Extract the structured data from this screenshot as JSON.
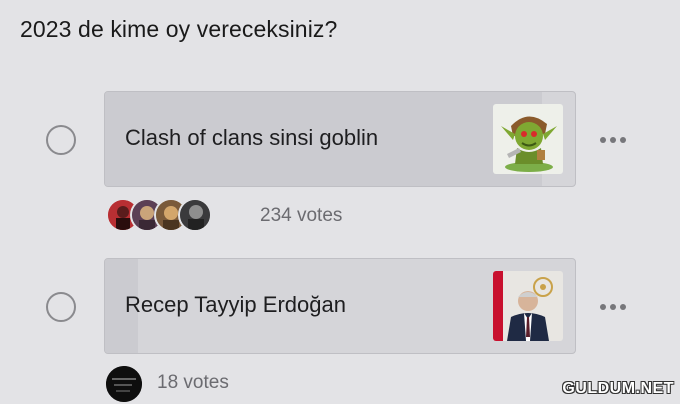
{
  "poll": {
    "question": "2023 de kime oy vereceksiniz?",
    "options": [
      {
        "label": "Clash of clans sinsi goblin",
        "votes_text": "234 votes",
        "votes": 234,
        "fill_fraction": 0.93
      },
      {
        "label": "Recep Tayyip Erdoğan",
        "votes_text": "18 votes",
        "votes": 18,
        "fill_fraction": 0.07
      }
    ]
  },
  "icons": {
    "more": "more-horizontal-icon",
    "radio": "radio-unselected-icon"
  },
  "colors": {
    "background": "#e3e3e6",
    "card": "#d5d5d9",
    "text": "#1c1c1e",
    "muted": "#6b6b70"
  },
  "watermark": "GULDUM.NET"
}
